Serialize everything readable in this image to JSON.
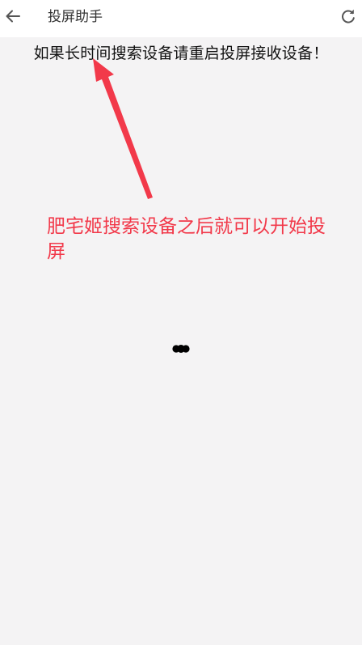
{
  "header": {
    "title": "投屏助手",
    "back_icon": "back-arrow-icon",
    "refresh_icon": "refresh-icon"
  },
  "main": {
    "hint_text": "如果长时间搜索设备请重启投屏接收设备！",
    "annotation_text": "肥宅姬搜索设备之后就可以开始投屏",
    "loading_icon": "loading-dots-icon"
  },
  "colors": {
    "background": "#f4f3f4",
    "header_background": "#ffffff",
    "annotation": "#f2394a"
  }
}
